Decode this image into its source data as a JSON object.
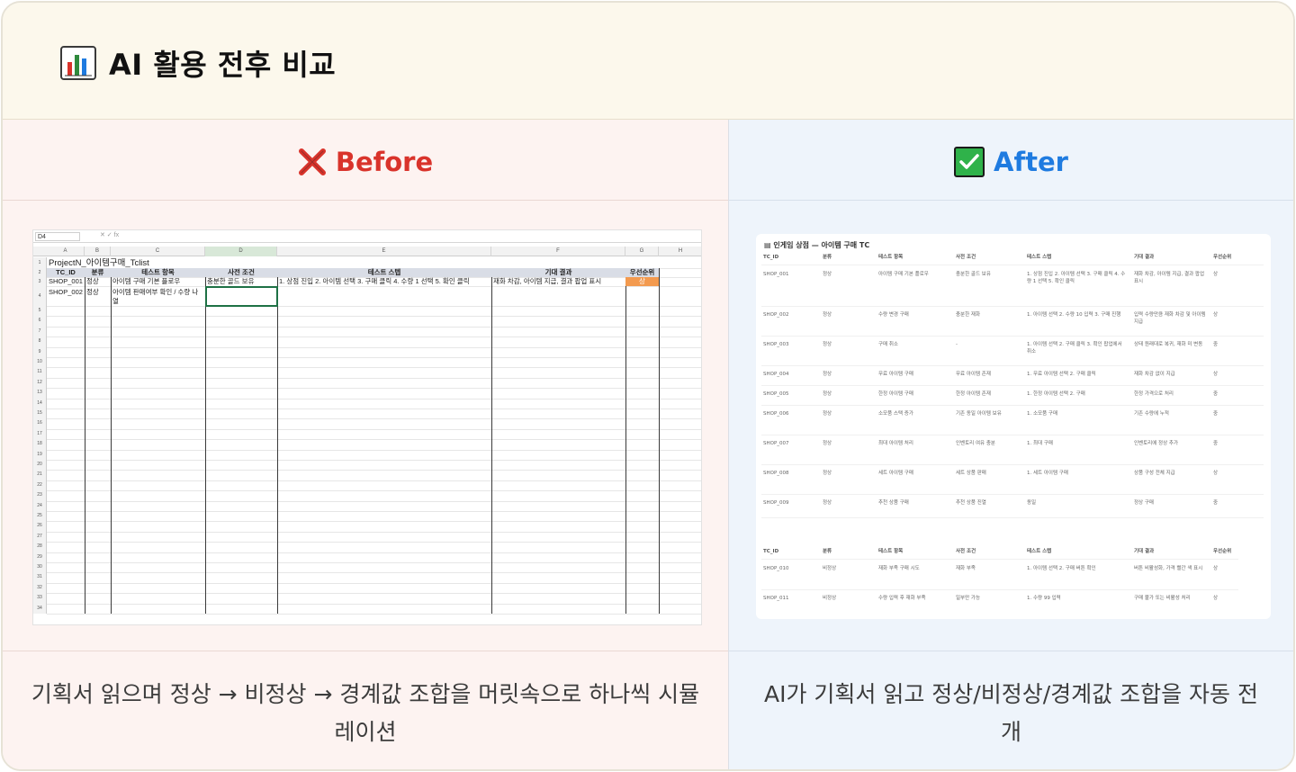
{
  "header": {
    "title": "AI 활용 전후 비교",
    "icon": "bar-chart-icon"
  },
  "before": {
    "label": "Before",
    "icon": "cross-mark-icon",
    "accent": "#d9332b",
    "caption": "기획서 읽으며 정상 → 비정상 → 경계값 조합을 머릿속으로 하나씩 시뮬레이션",
    "excel": {
      "name_box": "D4",
      "fx": "✕ ✓ fx",
      "columns": [
        "A",
        "B",
        "C",
        "D",
        "E",
        "F",
        "G",
        "H"
      ],
      "sheet_title": "ProjectN_아이템구매_Tclist",
      "headers": [
        "TC_ID",
        "분류",
        "테스트 항목",
        "사전 조건",
        "테스트 스텝",
        "기대 결과",
        "우선순위"
      ],
      "rows": [
        [
          "SHOP_001",
          "정상",
          "아이템 구매 기본 플로우",
          "충분한 골드 보유",
          "1. 상점 진입 2. 아이템 선택 3. 구매 클릭 4. 수량 1 선택 5. 확인 클릭",
          "재화 차감, 아이템 지급, 결과 팝업 표시",
          "상"
        ],
        [
          "SHOP_002",
          "정상",
          "아이템 판매여부 확인 / 수량 나열",
          "",
          "",
          "",
          ""
        ]
      ],
      "row_numbers": [
        "1",
        "2",
        "3",
        "4",
        "5",
        "6",
        "7",
        "8",
        "9",
        "10",
        "11",
        "12",
        "13",
        "14",
        "15",
        "16",
        "17",
        "18",
        "19",
        "20",
        "21",
        "22",
        "23",
        "24",
        "25",
        "26",
        "27",
        "28",
        "29",
        "30",
        "31",
        "32",
        "33",
        "34"
      ]
    }
  },
  "after": {
    "label": "After",
    "icon": "check-mark-icon",
    "accent": "#1f7be0",
    "caption": "AI가 기획서 읽고 정상/비정상/경계값 조합을 자동 전개",
    "notion": {
      "title": "인게임 상점 — 아이템 구매 TC",
      "headers": [
        "TC_ID",
        "분류",
        "테스트 항목",
        "사전 조건",
        "테스트 스텝",
        "기대 결과",
        "우선순위"
      ],
      "rows": [
        [
          "SHOP_001",
          "정상",
          "아이템 구매 기본 플로우",
          "충분한 골드 보유",
          "1. 상점 진입 2. 아이템 선택 3. 구매 클릭 4. 수량 1 선택 5. 확인 클릭",
          "재화 차감, 아이템 지급, 결과 팝업 표시",
          "상"
        ],
        [
          "SHOP_002",
          "정상",
          "수량 변경 구매",
          "충분한 재화",
          "1. 아이템 선택 2. 수량 10 입력 3. 구매 진행",
          "입력 수량만큼 재화 차감 및 아이템 지급",
          "상"
        ],
        [
          "SHOP_003",
          "정상",
          "구매 취소",
          "-",
          "1. 아이템 선택 2. 구매 클릭 3. 확인 팝업에서 취소",
          "상태 원래대로 복귀, 재화 미 변동",
          "중"
        ],
        [
          "SHOP_004",
          "정상",
          "무료 아이템 구매",
          "무료 아이템 존재",
          "1. 무료 아이템 선택 2. 구매 클릭",
          "재화 차감 없이 지급",
          "상"
        ],
        [
          "SHOP_005",
          "정상",
          "한정 아이템 구매",
          "한정 아이템 존재",
          "1. 한정 아이템 선택 2. 구매",
          "한정 가격으로 처리",
          "중"
        ],
        [
          "SHOP_006",
          "정상",
          "소모품 스택 증가",
          "기존 동일 아이템 보유",
          "1. 소모품 구매",
          "기존 수량에 누적",
          "중"
        ],
        [
          "SHOP_007",
          "정상",
          "최대 아이템 처리",
          "인벤토리 여유 충분",
          "1. 최대 구매",
          "인벤토리에 정상 추가",
          "중"
        ],
        [
          "SHOP_008",
          "정상",
          "세트 아이템 구매",
          "세트 상품 판매",
          "1. 세트 아이템 구매",
          "상품 구성 전체 지급",
          "상"
        ],
        [
          "SHOP_009",
          "정상",
          "추천 상품 구매",
          "추천 상품 진열",
          "동일",
          "정상 구매",
          "중"
        ]
      ],
      "rows2": [
        [
          "SHOP_010",
          "비정상",
          "재화 부족 구매 시도",
          "재화 부족",
          "1. 아이템 선택 2. 구매 버튼 확인",
          "버튼 비활성화, 가격 빨간 색 표시",
          "상"
        ],
        [
          "SHOP_011",
          "비정상",
          "수량 입력 후 재화 부족",
          "일부만 가능",
          "1. 수량 99 입력",
          "구매 불가 또는 비활성 처리",
          "상"
        ]
      ]
    }
  }
}
